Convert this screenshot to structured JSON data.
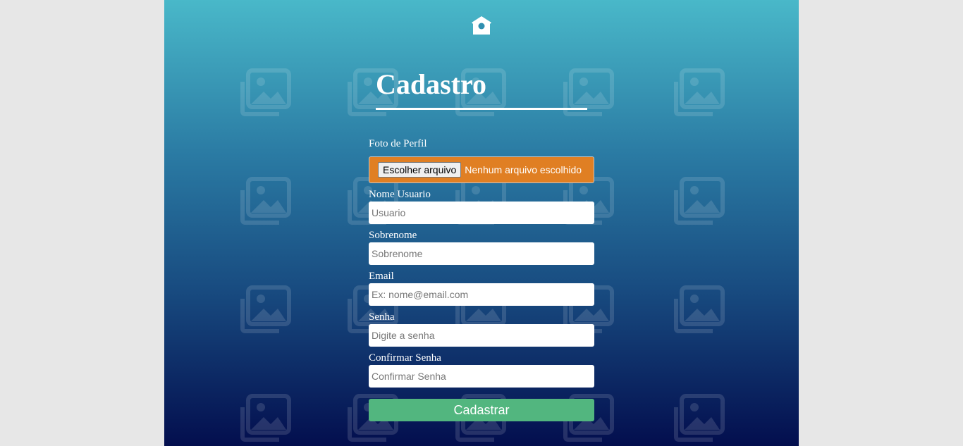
{
  "header": {
    "home_icon": "home-icon"
  },
  "title": "Cadastro",
  "form": {
    "profile_photo": {
      "label": "Foto de Perfil",
      "button_label": "Escolher arquivo",
      "status": "Nenhum arquivo escolhido"
    },
    "username": {
      "label": "Nome Usuario",
      "placeholder": "Usuario",
      "value": ""
    },
    "lastname": {
      "label": "Sobrenome",
      "placeholder": "Sobrenome",
      "value": ""
    },
    "email": {
      "label": "Email",
      "placeholder": "Ex: nome@email.com",
      "value": ""
    },
    "password": {
      "label": "Senha",
      "placeholder": "Digite a senha",
      "value": ""
    },
    "confirm_password": {
      "label": "Confirmar Senha",
      "placeholder": "Confirmar Senha",
      "value": ""
    },
    "submit_label": "Cadastrar"
  },
  "colors": {
    "gradient_top": "#49b8c9",
    "gradient_bottom": "#030e4e",
    "file_box": "#e07f23",
    "submit_button": "#52b67f",
    "page_background": "#e7e7e7"
  }
}
